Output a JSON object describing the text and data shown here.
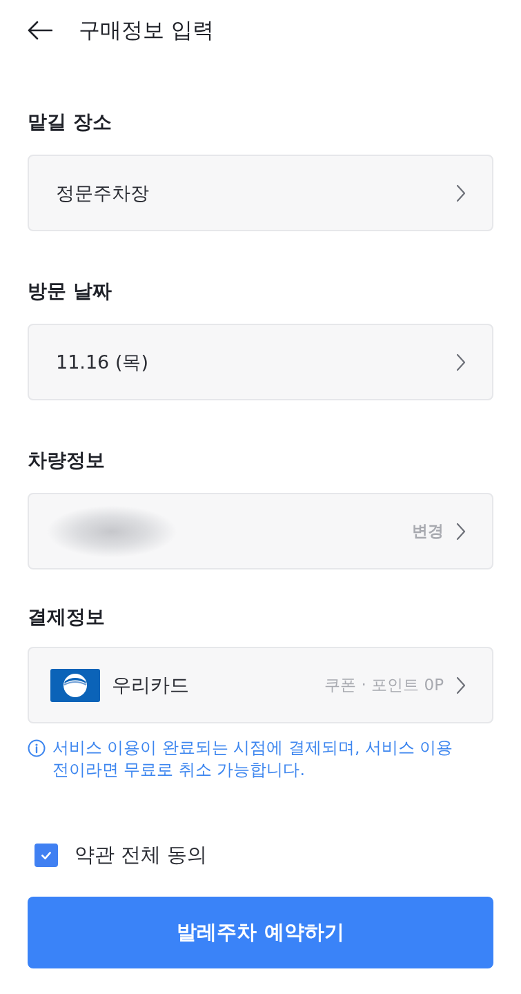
{
  "header": {
    "title": "구매정보 입력"
  },
  "sections": [
    {
      "kind": "select",
      "label": "맡길 장소",
      "value": "정문주차장"
    },
    {
      "kind": "select",
      "label": "방문 날짜",
      "value": "11.16 (목)"
    },
    {
      "kind": "vehicle",
      "label": "차량정보",
      "value_blurred": true,
      "action": "변경"
    },
    {
      "kind": "payment",
      "label": "결제정보",
      "card_name": "우리카드",
      "benefits": "쿠폰 · 포인트 0P",
      "note": "서비스 이용이 완료되는 시점에 결제되며, 서비스 이용 전이라면 무료로 취소 가능합니다."
    }
  ],
  "agreement": {
    "label": "약관 전체 동의",
    "checked": true
  },
  "submit_button": {
    "label": "발레주차 예약하기"
  }
}
